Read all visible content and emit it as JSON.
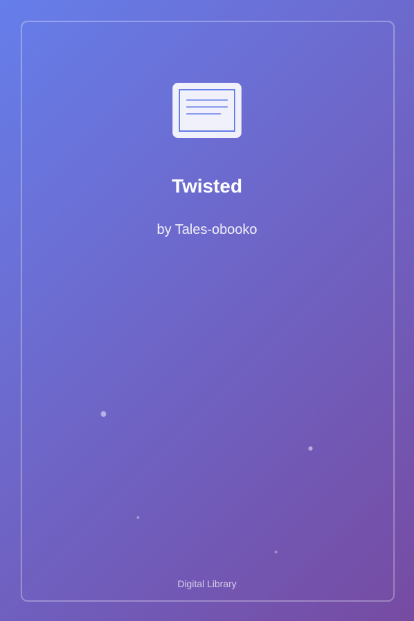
{
  "cover": {
    "title": "Twisted",
    "author": "by Tales-obooko",
    "footer": "Digital Library",
    "icon": "book-icon"
  },
  "colors": {
    "gradient_start": "#667eea",
    "gradient_end": "#764ba2",
    "icon_stroke": "#667eea",
    "text": "#ffffff"
  }
}
